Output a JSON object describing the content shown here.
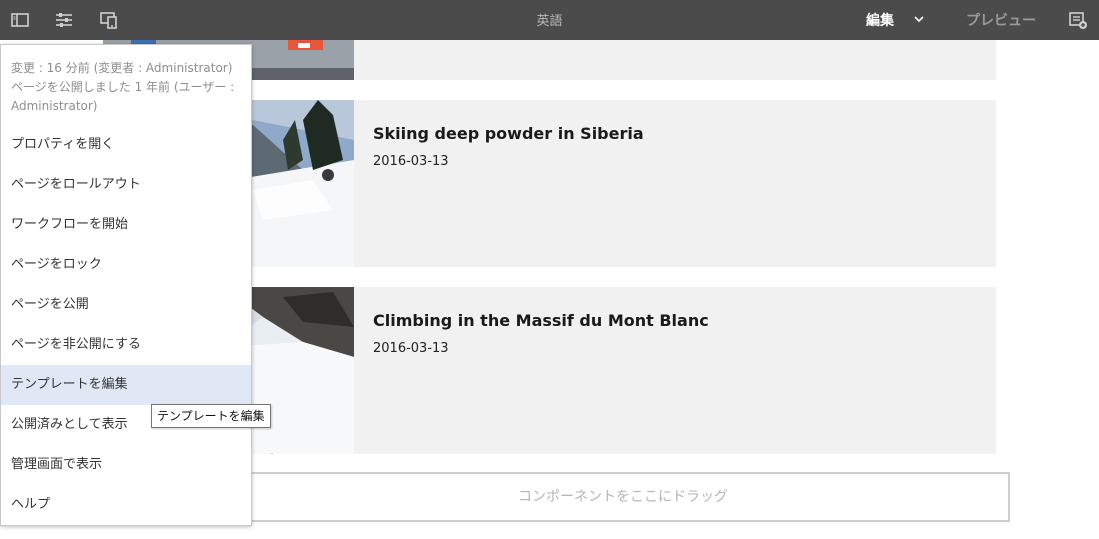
{
  "topbar": {
    "title": "英語",
    "edit_label": "編集",
    "preview_label": "プレビュー",
    "icons": [
      "side-panel-icon",
      "page-properties-icon",
      "emulator-icon",
      "chevron-down-icon",
      "annotate-icon"
    ]
  },
  "cards": [
    {
      "title": "",
      "date": ""
    },
    {
      "title": "Skiing deep powder in Siberia",
      "date": "2016-03-13"
    },
    {
      "title": "Climbing in the Massif du Mont Blanc",
      "date": "2016-03-13"
    }
  ],
  "dropzone": {
    "label": "コンポーネントをここにドラッグ"
  },
  "menu": {
    "meta": "変更 : 16 分前 (変更者 : Administrator) ページを公開しました 1 年前 (ユーザー : Administrator)",
    "items": [
      "プロパティを開く",
      "ページをロールアウト",
      "ワークフローを開始",
      "ページをロック",
      "ページを公開",
      "ページを非公開にする",
      "テンプレートを編集",
      "公開済みとして表示",
      "管理画面で表示",
      "ヘルプ"
    ],
    "active_item": "テンプレートを編集"
  },
  "tooltip": {
    "text": "テンプレートを編集"
  },
  "colors": {
    "topbar": "#4b4b4b",
    "card": "#f1f1f1",
    "menu_active": "#dfe8f4"
  }
}
